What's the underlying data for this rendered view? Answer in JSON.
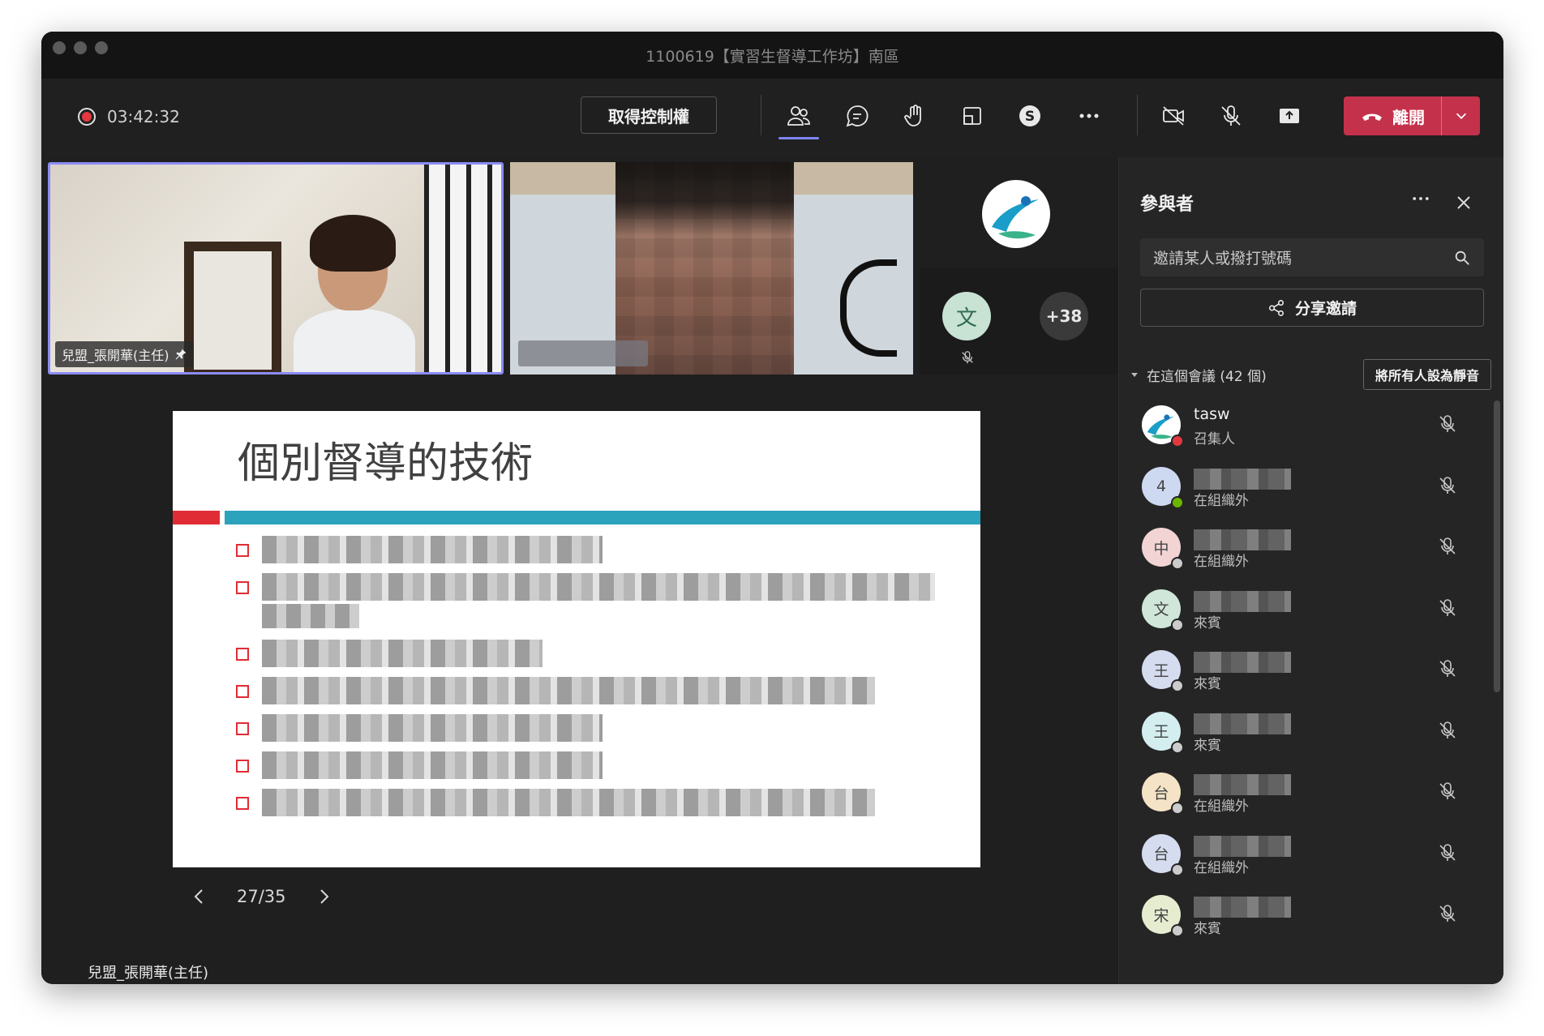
{
  "window": {
    "title": "1100619【實習生督導工作坊】南區"
  },
  "toolbar": {
    "timer": "03:42:32",
    "take_control_label": "取得控制權",
    "leave_label": "離開",
    "accent_color": "#7f85f5",
    "leave_color": "#c4314b"
  },
  "videos": {
    "main_name": "兒盟_張開華(主任)",
    "overflow_avatar_letter": "文",
    "overflow_count": "+38"
  },
  "slide": {
    "title": "個別督導的技術",
    "page": "27/35",
    "presenter": "兒盟_張開華(主任)"
  },
  "panel": {
    "title": "參與者",
    "search_placeholder": "邀請某人或撥打號碼",
    "share_label": "分享邀請",
    "section_label": "在這個會議 (42 個)",
    "mute_all_label": "將所有人設為靜音",
    "participants": [
      {
        "name": "tasw",
        "role": "召集人",
        "avatar": "",
        "avatar_bg": "#ffffff",
        "status_color": "#e2383f"
      },
      {
        "name": "",
        "role": "在組織外",
        "avatar": "4",
        "avatar_bg": "#cdd9f0",
        "status_color": "#6bb700"
      },
      {
        "name": "",
        "role": "在組織外",
        "avatar": "中",
        "avatar_bg": "#f2d4d4",
        "status_color": "#cccccc"
      },
      {
        "name": "",
        "role": "來賓",
        "avatar": "文",
        "avatar_bg": "#cfe6d9",
        "status_color": "#cccccc"
      },
      {
        "name": "",
        "role": "來賓",
        "avatar": "王",
        "avatar_bg": "#d5dcf0",
        "status_color": "#cccccc"
      },
      {
        "name": "",
        "role": "來賓",
        "avatar": "王",
        "avatar_bg": "#d4eef0",
        "status_color": "#cccccc"
      },
      {
        "name": "",
        "role": "在組織外",
        "avatar": "台",
        "avatar_bg": "#f4e3c6",
        "status_color": "#cccccc"
      },
      {
        "name": "",
        "role": "在組織外",
        "avatar": "台",
        "avatar_bg": "#d5dcf0",
        "status_color": "#cccccc"
      },
      {
        "name": "",
        "role": "來賓",
        "avatar": "宋",
        "avatar_bg": "#e6ecd0",
        "status_color": "#cccccc"
      }
    ]
  }
}
